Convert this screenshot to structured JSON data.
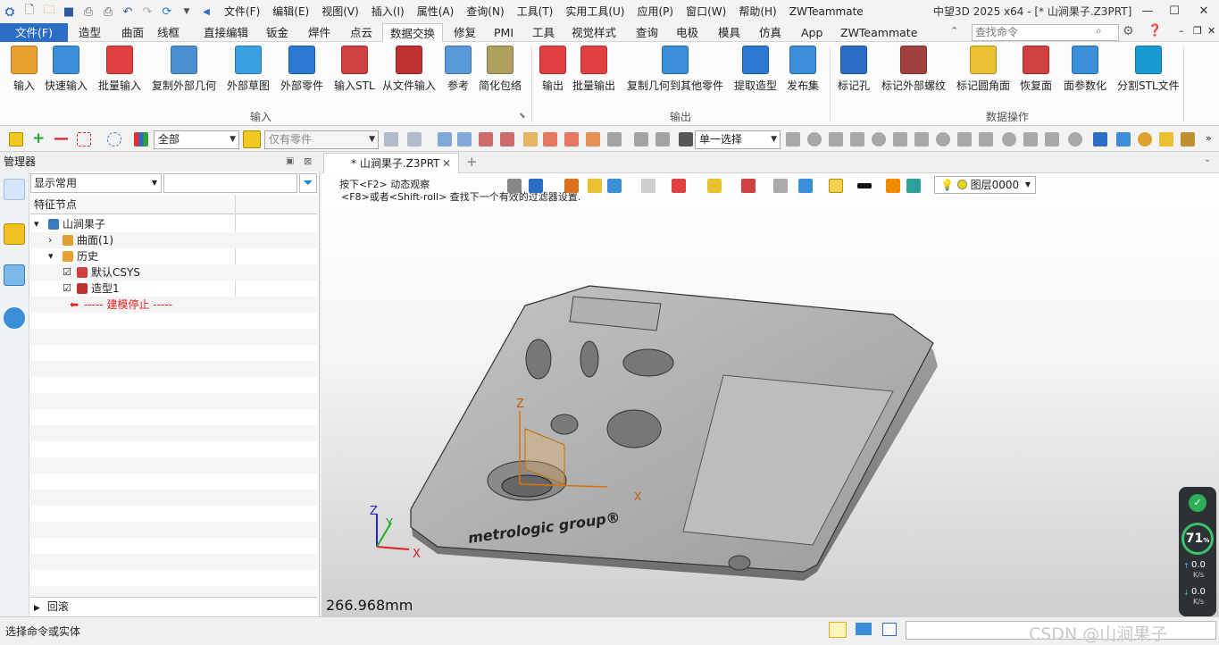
{
  "title_bar": {
    "app_title": "中望3D 2025 x64 - [* 山涧果子.Z3PRT]",
    "menus": [
      "文件(F)",
      "编辑(E)",
      "视图(V)",
      "插入(I)",
      "属性(A)",
      "查询(N)",
      "工具(T)",
      "实用工具(U)",
      "应用(P)",
      "窗口(W)",
      "帮助(H)",
      "ZWTeammate"
    ]
  },
  "ribbon_tabs": {
    "file": "文件(F)",
    "tabs": [
      "造型",
      "曲面",
      "线框",
      "直接编辑",
      "钣金",
      "焊件",
      "点云",
      "数据交换",
      "修复",
      "PMI",
      "工具",
      "视觉样式",
      "查询",
      "电极",
      "模具",
      "仿真",
      "App",
      "ZWTeammate"
    ],
    "active": "数据交换",
    "search_placeholder": "查找命令"
  },
  "ribbon": {
    "input_buttons": [
      "输入",
      "快速输入",
      "批量输入",
      "复制外部几何",
      "外部草图",
      "外部零件",
      "输入STL",
      "从文件输入",
      "参考",
      "简化包络"
    ],
    "input_group": "输入",
    "output_buttons": [
      "输出",
      "批量输出",
      "复制几何到其他零件",
      "提取造型",
      "发布集"
    ],
    "output_group": "输出",
    "data_buttons": [
      "标记孔",
      "标记外部螺纹",
      "标记圆角面",
      "恢复面",
      "面参数化",
      "分割STL文件"
    ],
    "data_group": "数据操作"
  },
  "toolbar": {
    "filter_value": "全部",
    "scope_value": "仅有零件",
    "select_mode": "单一选择"
  },
  "manager": {
    "title": "管理器",
    "display_filter": "显示常用",
    "column": "特征节点",
    "tree": [
      {
        "label": "山涧果子",
        "indent": 0
      },
      {
        "label": "曲面(1)",
        "indent": 1
      },
      {
        "label": "历史",
        "indent": 1
      },
      {
        "label": "默认CSYS",
        "indent": 2
      },
      {
        "label": "造型1",
        "indent": 2
      },
      {
        "label": "----- 建模停止 -----",
        "indent": 2
      }
    ],
    "rollback": "回滚"
  },
  "viewport": {
    "tab_label": "* 山涧果子.Z3PRT",
    "hint1": "按下<F2> 动态观察",
    "hint2": "<F8>或者<Shift-roll> 查找下一个有效的过滤器设置.",
    "layer": "图层0000",
    "dimension": "266.968mm",
    "engraving": "metrologic group®",
    "axis_z": "Z",
    "axis_y": "Y",
    "axis_x": "X"
  },
  "perf": {
    "percent": "71",
    "pct_sign": "%",
    "up": "0.0",
    "up_unit": "K/s",
    "down": "0.0",
    "down_unit": "K/s"
  },
  "status": {
    "text": "选择命令或实体",
    "watermark": "CSDN @山涧果子"
  }
}
